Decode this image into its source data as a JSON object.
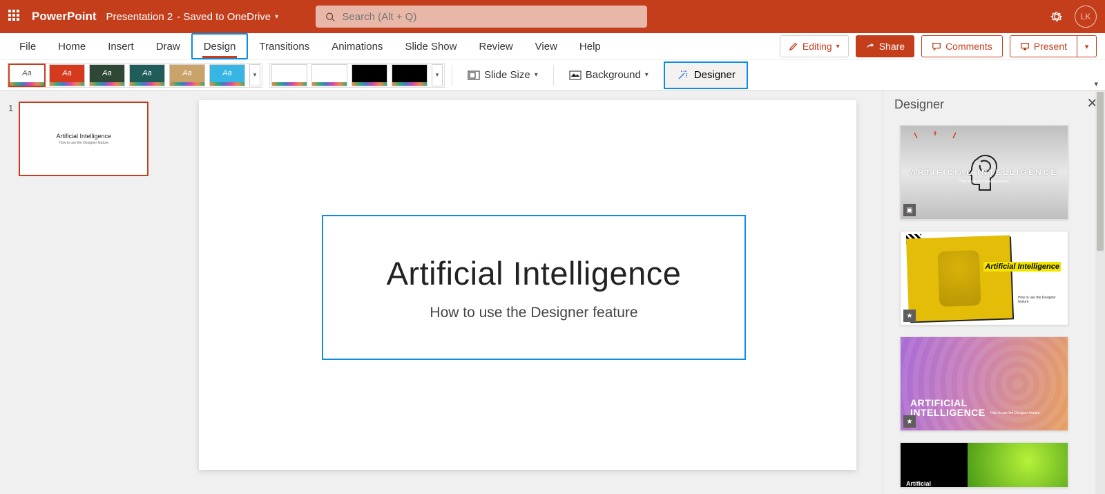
{
  "titlebar": {
    "app_name": "PowerPoint",
    "doc_name": "Presentation 2",
    "save_status": "- Saved to OneDrive",
    "search_placeholder": "Search (Alt + Q)",
    "user_initials": "LK"
  },
  "tabs": {
    "file": "File",
    "home": "Home",
    "insert": "Insert",
    "draw": "Draw",
    "design": "Design",
    "transitions": "Transitions",
    "animations": "Animations",
    "slideshow": "Slide Show",
    "review": "Review",
    "view": "View",
    "help": "Help"
  },
  "actions": {
    "editing": "Editing",
    "share": "Share",
    "comments": "Comments",
    "present": "Present"
  },
  "toolbar": {
    "slide_size": "Slide Size",
    "background": "Background",
    "designer": "Designer"
  },
  "thumbnails": {
    "slide1_num": "1",
    "slide1_title": "Artificial Intelligence",
    "slide1_sub": "How to use the Designer feature"
  },
  "slide": {
    "title": "Artificial Intelligence",
    "subtitle": "How to use the Designer feature"
  },
  "designer_pane": {
    "title": "Designer",
    "d1_title": "ARTIFICIAL INTELLIGENCE",
    "d1_sub": "How to use the Designer feature",
    "d2_title": "Artificial Intelligence",
    "d2_sub": "How to use the Designer feature",
    "d3_title_l1": "ARTIFICIAL",
    "d3_title_l2": "INTELLIGENCE",
    "d3_sub": "How to use the Designer feature",
    "d4_title": "Artificial"
  }
}
